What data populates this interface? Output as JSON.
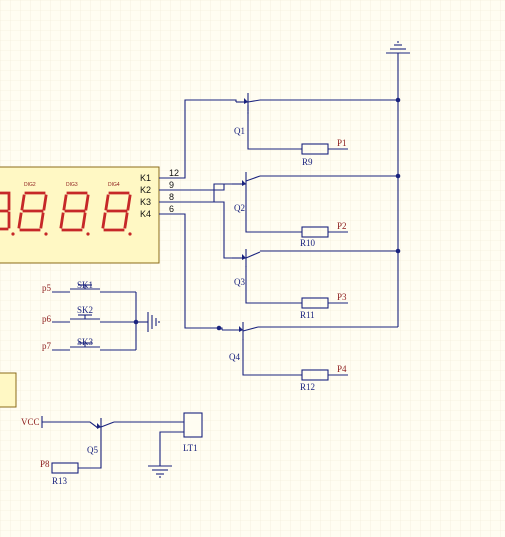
{
  "transistors": [
    {
      "ref": "Q1"
    },
    {
      "ref": "Q2"
    },
    {
      "ref": "Q3"
    },
    {
      "ref": "Q4"
    },
    {
      "ref": "Q5"
    }
  ],
  "resistors": [
    {
      "ref": "R9",
      "net": "P1"
    },
    {
      "ref": "R10",
      "net": "P2"
    },
    {
      "ref": "R11",
      "net": "P3"
    },
    {
      "ref": "R12",
      "net": "P4"
    },
    {
      "ref": "R13",
      "net": "P8"
    }
  ],
  "display": {
    "digit_labels": [
      "DIG2",
      "DIG3",
      "DIG4"
    ],
    "pin_labels": [
      "K1",
      "K2",
      "K3",
      "K4"
    ],
    "pin_numbers": [
      "12",
      "9",
      "8",
      "6"
    ]
  },
  "switches": [
    {
      "ref": "SK1",
      "net": "p5"
    },
    {
      "ref": "SK2",
      "net": "p6"
    },
    {
      "ref": "SK3",
      "net": "p7"
    }
  ],
  "supply": {
    "vcc": "VCC"
  },
  "buzzer": {
    "ref": "LT1"
  },
  "colors": {
    "wire": "#1a237e",
    "net_label": "#8b1a1a",
    "segment": "#c62828",
    "display_body": "#fff8c4",
    "grid": "#efe7d4"
  }
}
